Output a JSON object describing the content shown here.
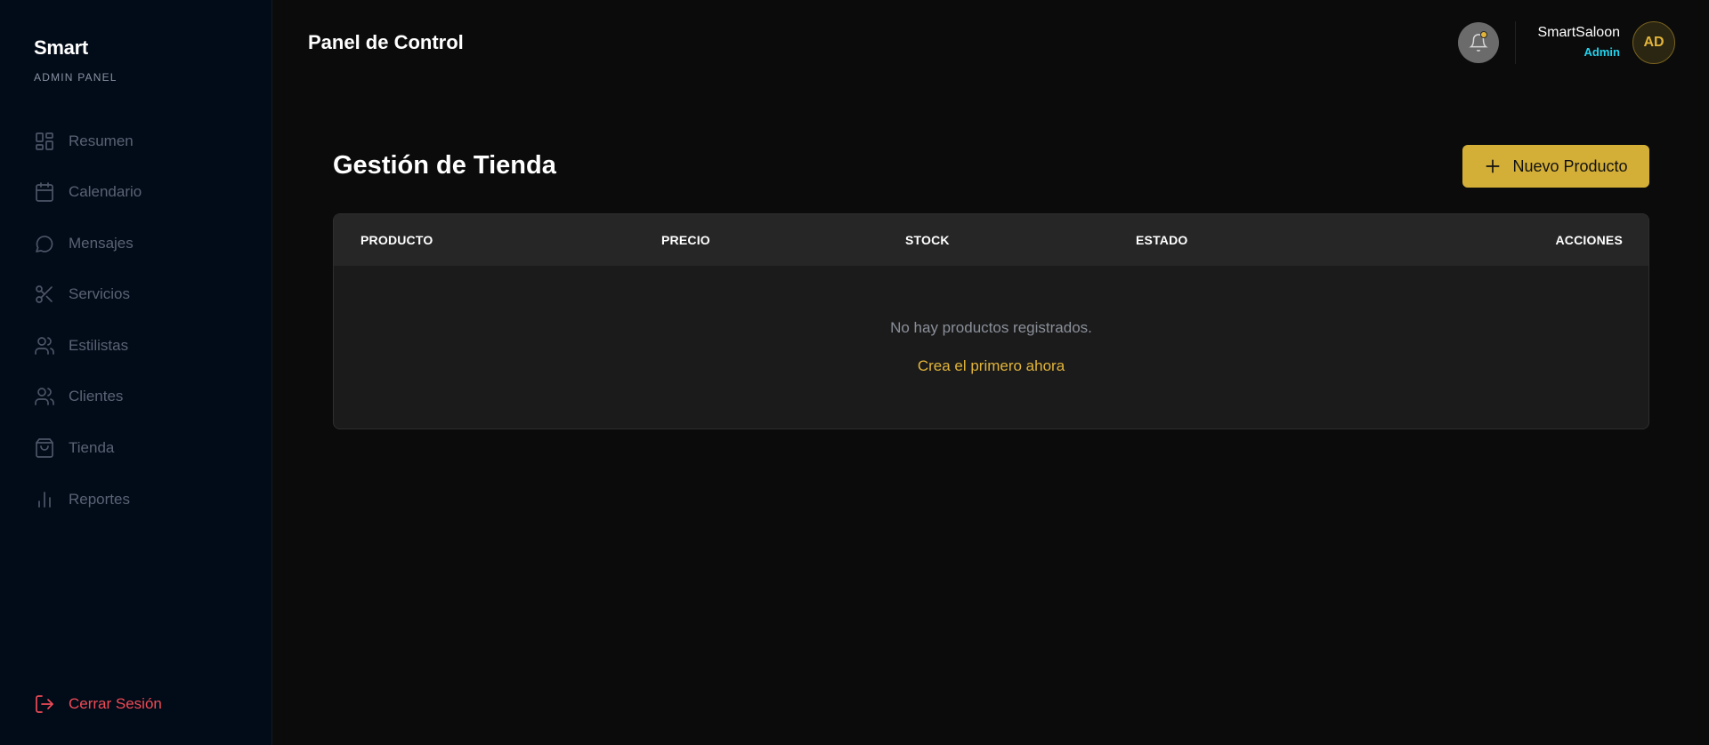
{
  "sidebar": {
    "brand_title": "Smart",
    "brand_subtitle": "ADMIN PANEL",
    "items": [
      {
        "label": "Resumen",
        "icon": "dashboard-icon"
      },
      {
        "label": "Calendario",
        "icon": "calendar-icon"
      },
      {
        "label": "Mensajes",
        "icon": "message-icon"
      },
      {
        "label": "Servicios",
        "icon": "scissors-icon"
      },
      {
        "label": "Estilistas",
        "icon": "users-icon"
      },
      {
        "label": "Clientes",
        "icon": "users-icon"
      },
      {
        "label": "Tienda",
        "icon": "shopping-bag-icon"
      },
      {
        "label": "Reportes",
        "icon": "bar-chart-icon"
      }
    ],
    "logout_label": "Cerrar Sesión",
    "logout_icon": "logout-icon"
  },
  "header": {
    "title": "Panel de Control",
    "notification_icon": "bell-icon",
    "user_name": "SmartSaloon",
    "user_role": "Admin",
    "avatar_initials": "AD"
  },
  "main": {
    "section_title": "Gestión de Tienda",
    "new_button_label": "Nuevo Producto",
    "table": {
      "columns": [
        "PRODUCTO",
        "PRECIO",
        "STOCK",
        "ESTADO",
        "ACCIONES"
      ],
      "empty_message": "No hay productos registrados.",
      "empty_action": "Crea el primero ahora"
    }
  },
  "colors": {
    "accent": "#d4af37",
    "sidebar_bg": "#020b18",
    "page_bg": "#0b0b0b",
    "logout": "#ef4b57",
    "role": "#22d3ee"
  }
}
